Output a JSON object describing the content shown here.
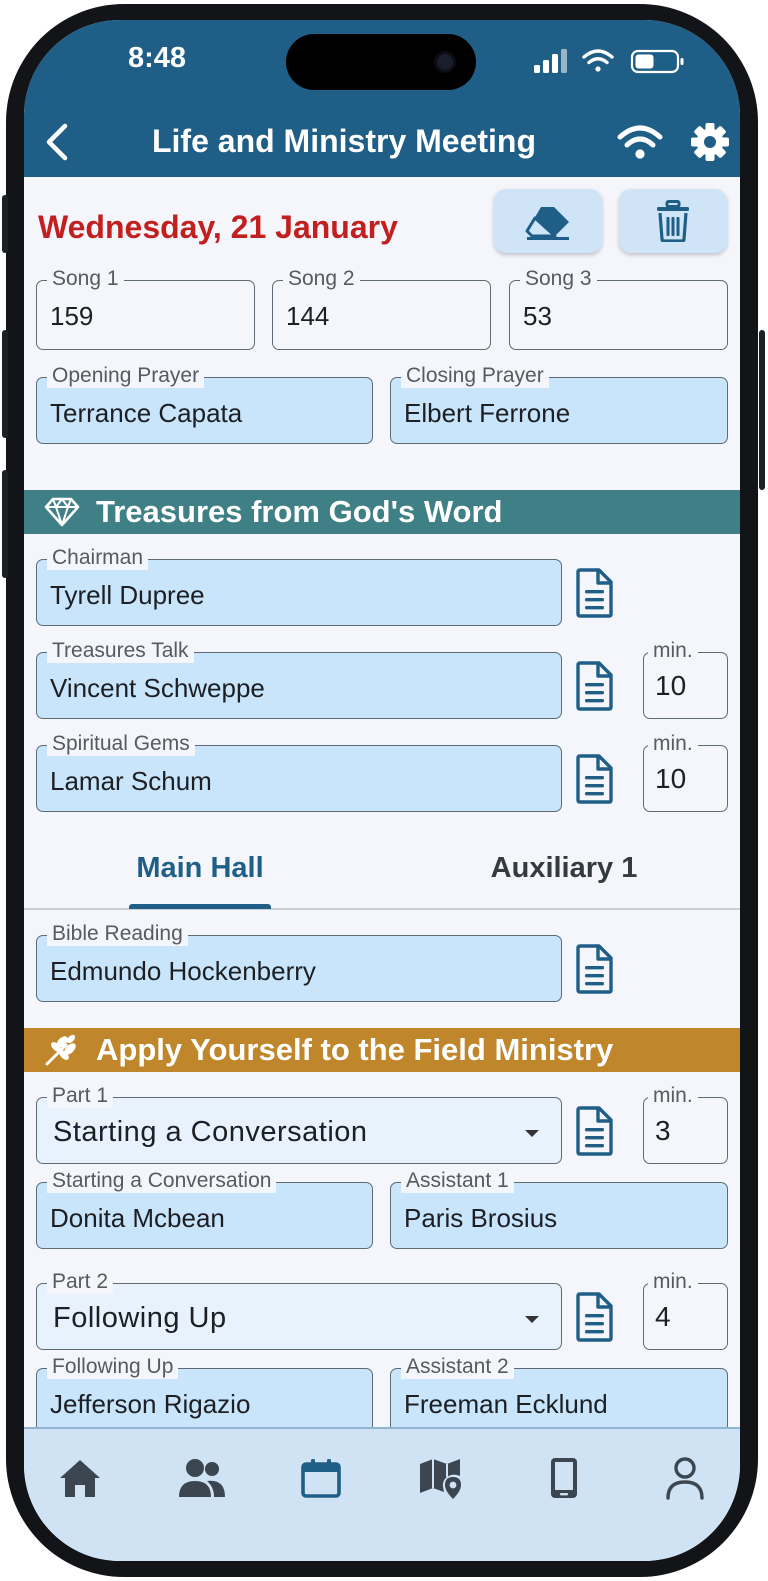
{
  "status": {
    "time": "8:48"
  },
  "appbar": {
    "title": "Life and Ministry Meeting"
  },
  "header": {
    "date": "Wednesday, 21 January"
  },
  "songs": [
    {
      "label": "Song 1",
      "value": "159"
    },
    {
      "label": "Song 2",
      "value": "144"
    },
    {
      "label": "Song 3",
      "value": "53"
    }
  ],
  "prayers": {
    "opening": {
      "label": "Opening Prayer",
      "value": "Terrance Capata"
    },
    "closing": {
      "label": "Closing Prayer",
      "value": "Elbert Ferrone"
    }
  },
  "treasures": {
    "title": "Treasures from God's Word",
    "color": "#3f7f86",
    "chairman": {
      "label": "Chairman",
      "value": "Tyrell Dupree"
    },
    "talk": {
      "label": "Treasures Talk",
      "value": "Vincent Schweppe",
      "min_label": "min.",
      "min": "10"
    },
    "gems": {
      "label": "Spiritual Gems",
      "value": "Lamar Schum",
      "min_label": "min.",
      "min": "10"
    }
  },
  "tabs": [
    {
      "label": "Main Hall",
      "active": true
    },
    {
      "label": "Auxiliary 1",
      "active": false
    }
  ],
  "bible_reading": {
    "label": "Bible Reading",
    "value": "Edmundo Hockenberry"
  },
  "ministry": {
    "title": "Apply Yourself to the Field Ministry",
    "color": "#c0862b",
    "part1": {
      "label": "Part 1",
      "value": "Starting a Conversation",
      "min_label": "min.",
      "min": "3",
      "student": {
        "label": "Starting a Conversation",
        "value": "Donita Mcbean"
      },
      "assistant": {
        "label": "Assistant 1",
        "value": "Paris Brosius"
      }
    },
    "part2": {
      "label": "Part 2",
      "value": "Following Up",
      "min_label": "min.",
      "min": "4",
      "student": {
        "label": "Following Up",
        "value": "Jefferson Rigazio"
      },
      "assistant": {
        "label": "Assistant 2",
        "value": "Freeman Ecklund"
      }
    }
  },
  "bottom_nav": [
    "home-icon",
    "people-icon",
    "calendar-icon",
    "map-pin-icon",
    "phone-icon",
    "person-icon"
  ],
  "colors": {
    "primary": "#1f5f87",
    "accent_red": "#c21f1f",
    "field_fill": "#c9e5fb"
  }
}
